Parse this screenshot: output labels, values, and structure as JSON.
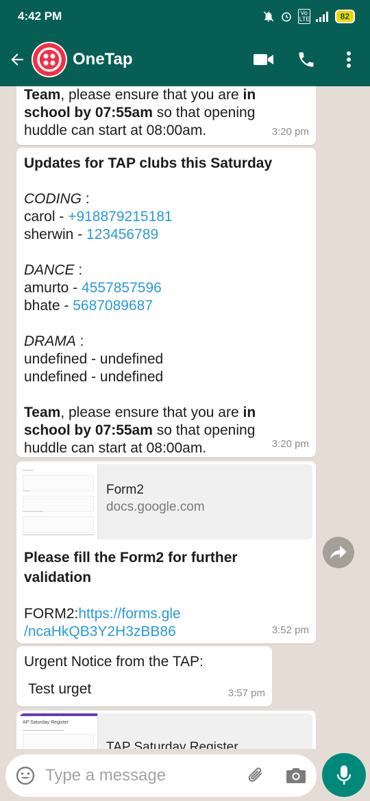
{
  "status_bar": {
    "time": "4:42 PM",
    "network": "Vo LTE",
    "battery": "82"
  },
  "header": {
    "title": "OneTap"
  },
  "messages": [
    {
      "line1_bold": "Team",
      "line1_rest": ", please ensure that you are ",
      "line1_bold2": "in",
      "line2_bold": "school by 07:55am",
      "line2_rest": " so that opening",
      "line3": "huddle can start at 08:00am.",
      "time": "3:20 pm"
    },
    {
      "title": "Updates for TAP clubs this Saturday",
      "coding": {
        "heading": "CODING",
        "sep": " :",
        "r1_name": "carol - ",
        "r1_phone": "+918879215181",
        "r2_name": "sherwin - ",
        "r2_phone": "123456789"
      },
      "dance": {
        "heading": "DANCE",
        "sep": " :",
        "r1_name": "amurto - ",
        "r1_phone": "4557857596",
        "r2_name": "bhate - ",
        "r2_phone": "5687089687"
      },
      "drama": {
        "heading": "DRAMA",
        "sep": " :",
        "r1": "undefined - undefined",
        "r2": "undefined - undefined"
      },
      "footer_bold": "Team",
      "footer_rest": ", please ensure that you are ",
      "footer_bold2": "in",
      "footer2_bold": "school by 07:55am",
      "footer2_rest": " so that opening",
      "footer3": "huddle can start at 08:00am.",
      "time": "3:20 pm"
    },
    {
      "preview_title": "Form2",
      "preview_domain": "docs.google.com",
      "title_line1": "Please fill the Form2 for further",
      "title_line2": "validation",
      "link_label": "FORM2:",
      "link_line1": "https://forms.gle",
      "link_line2": "/ncaHkQB3Y2H3zBB86",
      "time": "3:52 pm"
    },
    {
      "line1": "Urgent Notice from the TAP:",
      "line2": "Test urget",
      "time": "3:57 pm"
    },
    {
      "preview_title": "TAP Saturday Register"
    }
  ],
  "input": {
    "placeholder": "Type a message"
  },
  "icons": {
    "back": "back-arrow-icon",
    "avatar": "twilio-logo-icon",
    "video": "video-call-icon",
    "call": "phone-icon",
    "menu": "more-vert-icon",
    "emoji": "emoji-icon",
    "attach": "paperclip-icon",
    "camera": "camera-icon",
    "mic": "microphone-icon",
    "forward": "forward-icon"
  },
  "colors": {
    "header": "#075e54",
    "link": "#2a9ad8",
    "mic": "#00897b",
    "background": "#e5ddd5"
  }
}
